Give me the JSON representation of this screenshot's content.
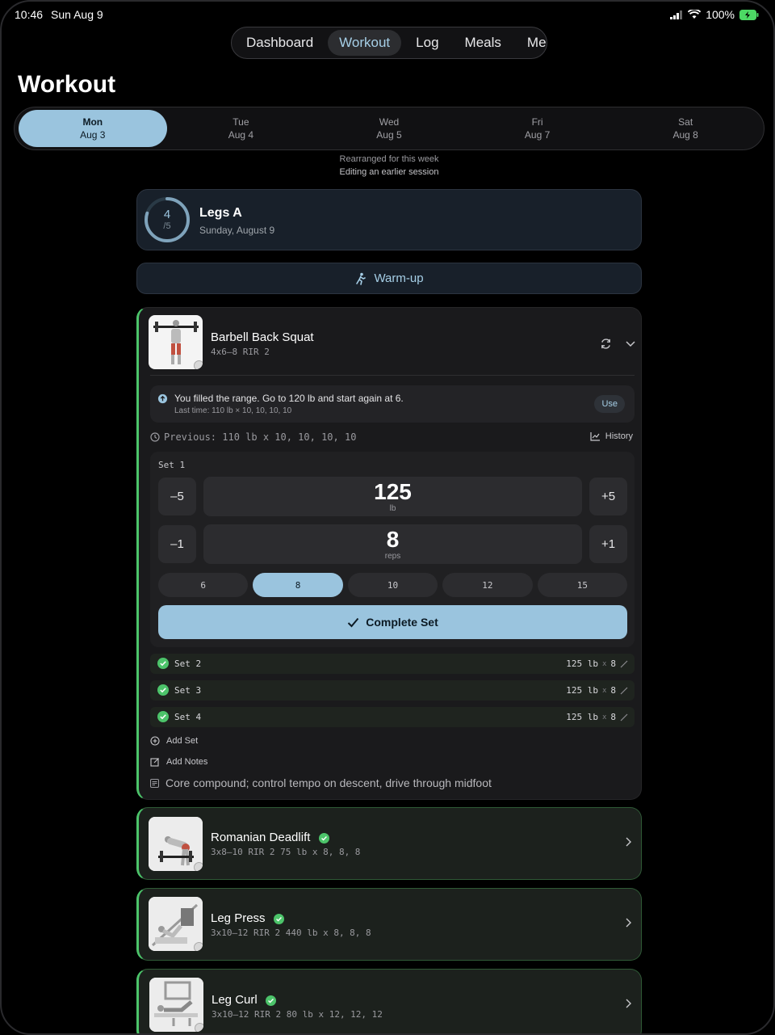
{
  "status": {
    "time": "10:46",
    "date": "Sun Aug 9",
    "battery": "100%"
  },
  "nav": {
    "tabs": [
      {
        "label": "Dashboard"
      },
      {
        "label": "Workout"
      },
      {
        "label": "Log"
      },
      {
        "label": "Meals"
      },
      {
        "label": "Me"
      }
    ],
    "active": "Workout"
  },
  "page_title": "Workout",
  "days": [
    {
      "name": "Mon",
      "date": "Aug 3"
    },
    {
      "name": "Tue",
      "date": "Aug 4"
    },
    {
      "name": "Wed",
      "date": "Aug 5"
    },
    {
      "name": "Fri",
      "date": "Aug 7"
    },
    {
      "name": "Sat",
      "date": "Aug 8"
    }
  ],
  "notes": {
    "line1": "Rearranged for this week",
    "line2": "Editing an earlier session"
  },
  "session": {
    "done": "4",
    "total": "/5",
    "progress": 0.8,
    "title": "Legs A",
    "date": "Sunday, August 9"
  },
  "warmup": {
    "label": "Warm-up"
  },
  "exercise": {
    "name": "Barbell Back Squat",
    "scheme": "4x6–8 RIR 2",
    "hint": {
      "message": "You filled the range. Go to 120 lb and start again at 6.",
      "last": "Last time: 110 lb × 10, 10, 10, 10",
      "use_label": "Use"
    },
    "previous": "Previous: 110 lb x 10, 10, 10, 10",
    "history_label": "History",
    "set_label": "Set 1",
    "weight": {
      "value": "125",
      "unit": "lb",
      "minus": "–5",
      "plus": "+5"
    },
    "reps": {
      "value": "8",
      "unit": "reps",
      "minus": "–1",
      "plus": "+1"
    },
    "rep_chips": [
      "6",
      "8",
      "10",
      "12",
      "15"
    ],
    "complete_label": "Complete Set",
    "done_sets": [
      {
        "label": "Set 2",
        "weight": "125 lb",
        "x": "x",
        "reps": "8"
      },
      {
        "label": "Set 3",
        "weight": "125 lb",
        "x": "x",
        "reps": "8"
      },
      {
        "label": "Set 4",
        "weight": "125 lb",
        "x": "x",
        "reps": "8"
      }
    ],
    "add_set": "Add Set",
    "add_notes": "Add Notes",
    "note": "Core compound; control tempo on descent, drive through midfoot"
  },
  "other_exercises": [
    {
      "name": "Romanian Deadlift",
      "detail": "3x8–10 RIR 2 75 lb x 8, 8, 8"
    },
    {
      "name": "Leg Press",
      "detail": "3x10–12 RIR 2 440 lb x 8, 8, 8"
    },
    {
      "name": "Leg Curl",
      "detail": "3x10–12 RIR 2 80 lb x 12, 12, 12"
    }
  ],
  "colors": {
    "accent": "#9ac4de",
    "success": "#4cc46a",
    "background": "#000000"
  }
}
